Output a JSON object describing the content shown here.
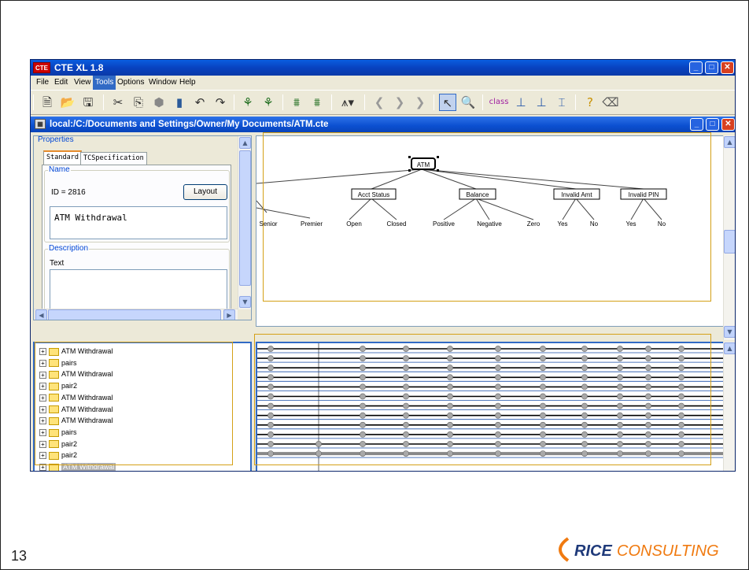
{
  "slide": {
    "page_number": "13"
  },
  "logo": {
    "part1": "RICE",
    "part2": "CONSULTING",
    "accent": "#f07a10",
    "navy": "#1f3a7a"
  },
  "app": {
    "title": "CTE XL 1.8",
    "icon_label": "CTE",
    "menu": [
      "File",
      "Edit",
      "View",
      "Tools",
      "Options",
      "Window",
      "Help"
    ],
    "active_menu": "Tools",
    "toolbar_icons": [
      "document-icon",
      "open-folder-icon",
      "save-icon",
      "cut-icon",
      "copy-icon",
      "paste-icon",
      "delete-icon",
      "undo-icon",
      "redo-icon",
      "tree-layout-icon",
      "tree-layout-alt-icon",
      "classify-icon",
      "classify-alt-icon",
      "triangle-menu-icon",
      "back-icon",
      "up-icon",
      "forward-icon",
      "select-tool-icon",
      "zoom-icon",
      "class-tool-icon",
      "split-icon",
      "split-alt-icon",
      "align-icon",
      "help-icon",
      "clear-icon"
    ]
  },
  "document": {
    "title": "local:/C:/Documents and Settings/Owner/My Documents/ATM.cte"
  },
  "properties": {
    "legend": "Properties",
    "tabs": [
      "Standard",
      "TCSpecification"
    ],
    "active_tab": "Standard",
    "name_legend": "Name",
    "id_text": "ID = 2816",
    "layout_button": "Layout",
    "name_value": "ATM Withdrawal",
    "description_legend": "Description",
    "text_label": "Text"
  },
  "tree": {
    "root": "ATM",
    "classifications": [
      "Acct Status",
      "Balance",
      "Invalid Amt",
      "Invalid PIN"
    ],
    "classes": {
      "offscreen": [
        "Senior",
        "Premier"
      ],
      "acct_status": [
        "Open",
        "Closed"
      ],
      "balance": [
        "Positive",
        "Negative",
        "Zero"
      ],
      "invalid_amt": [
        "Yes",
        "No"
      ],
      "invalid_pin": [
        "Yes",
        "No"
      ]
    }
  },
  "outline": {
    "items": [
      "ATM Withdrawal",
      "pairs",
      "ATM Withdrawal",
      "pair2",
      "ATM Withdrawal",
      "ATM Withdrawal",
      "ATM Withdrawal",
      "pairs",
      "pair2",
      "pair2",
      "ATM Withdrawal"
    ],
    "selected_index": 10
  }
}
